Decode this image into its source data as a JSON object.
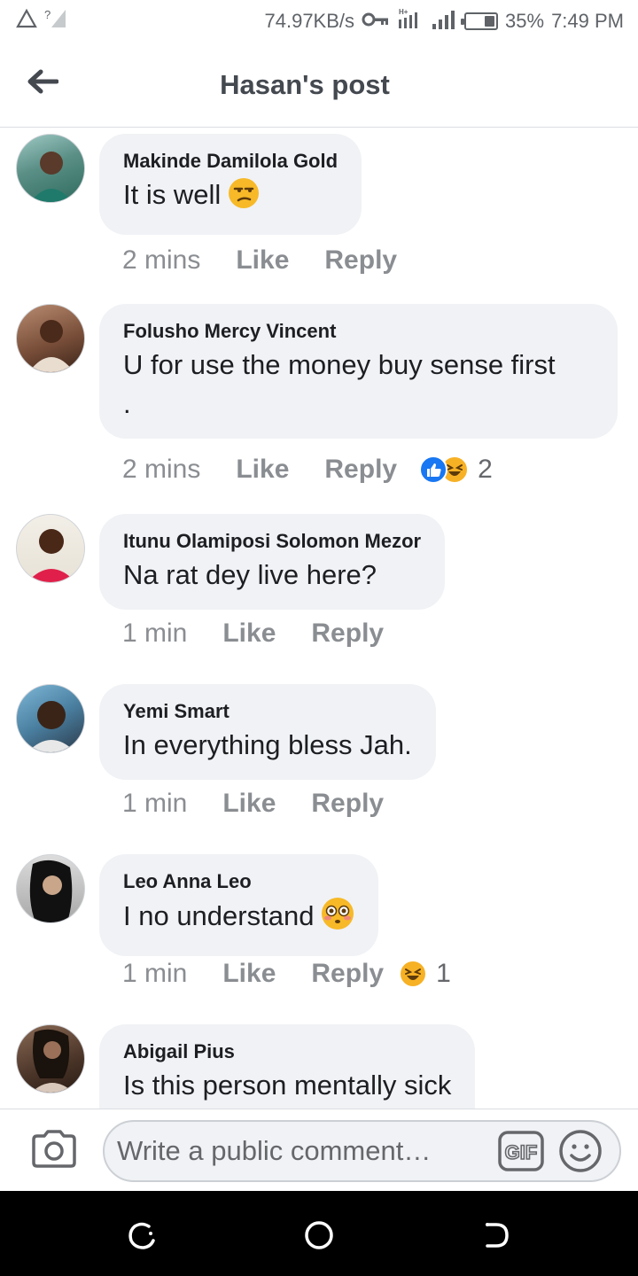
{
  "status_bar": {
    "speed": "74.97KB/s",
    "battery_percent": "35%",
    "battery_level": 0.35,
    "time": "7:49 PM",
    "icons": [
      "warning-icon",
      "no-sim-signal-icon",
      "vpn-key-icon",
      "data-signal-icon",
      "signal-icon",
      "battery-icon"
    ]
  },
  "header": {
    "title": "Hasan's post",
    "back_icon": "back-arrow-icon"
  },
  "comments": [
    {
      "author": "Makinde Damilola Gold",
      "text": "It is well",
      "emoji": "unamused-face",
      "time": "2 mins",
      "like": "Like",
      "reply": "Reply"
    },
    {
      "author": "Folusho Mercy Vincent",
      "text": "U for use the money buy sense first",
      "text2": ".",
      "time": "2 mins",
      "like": "Like",
      "reply": "Reply",
      "reactions": [
        "like",
        "laughing"
      ],
      "reaction_count": "2"
    },
    {
      "author": "Itunu Olamiposi Solomon Mezor",
      "text": "Na rat dey live here?",
      "time": "1 min",
      "like": "Like",
      "reply": "Reply"
    },
    {
      "author": "Yemi Smart",
      "text": "In everything bless Jah.",
      "time": "1 min",
      "like": "Like",
      "reply": "Reply"
    },
    {
      "author": "Leo Anna Leo",
      "text": "I no understand",
      "emoji": "flushed-face",
      "time": "1 min",
      "like": "Like",
      "reply": "Reply",
      "reactions": [
        "laughing"
      ],
      "reaction_count": "1"
    },
    {
      "author": "Abigail Pius",
      "text": "Is this person mentally sick"
    }
  ],
  "composer": {
    "placeholder": "Write a public comment…",
    "camera_icon": "camera-icon",
    "gif_label": "GIF",
    "emoji_icon": "smiley-icon"
  },
  "navbar": {
    "icons": [
      "recents-icon",
      "home-icon",
      "back-icon"
    ]
  },
  "colors": {
    "bubble": "#f0f2f5",
    "meta_text": "#8a8d91",
    "like_blue": "#1877f2",
    "haha_yellow": "#f7b125"
  }
}
